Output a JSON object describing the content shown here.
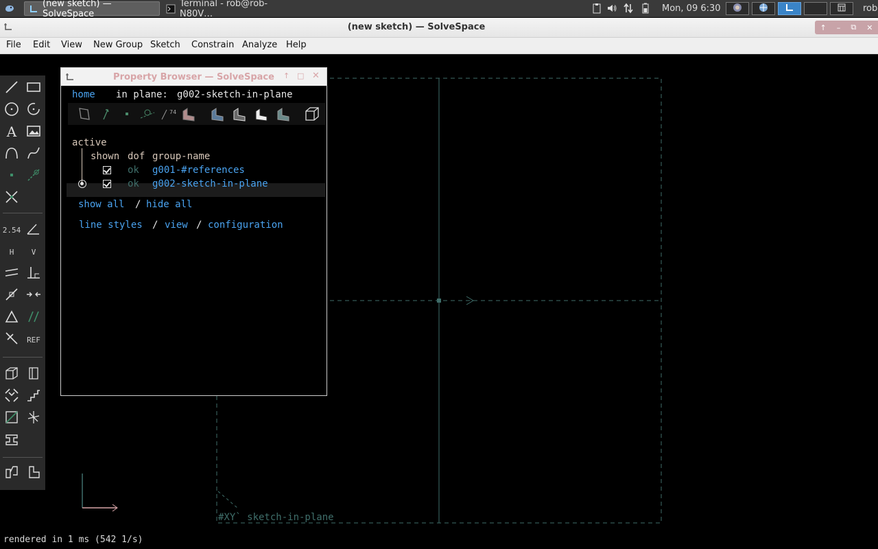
{
  "taskbar": {
    "tasks": [
      {
        "label": "(new sketch) — SolveSpace",
        "active": true
      },
      {
        "label": "Terminal - rob@rob-N80V…",
        "active": false
      }
    ],
    "clock": "Mon, 09  6:30",
    "user": "rob"
  },
  "window": {
    "title": "(new sketch) — SolveSpace",
    "menu": [
      "File",
      "Edit",
      "View",
      "New Group",
      "Sketch",
      "Constrain",
      "Analyze",
      "Help"
    ]
  },
  "toolbar": {
    "dimension_label": "2.54",
    "angle_label": "74°",
    "horizontal_label": "H",
    "vertical_label": "V",
    "reference_label": "REF",
    "icons": [
      "line-segment",
      "rectangle",
      "circle",
      "arc",
      "text",
      "image",
      "tangent-arc",
      "bezier-spline",
      "datum-point",
      "construction",
      "split-curves",
      "distance-dimension",
      "angle-dimension",
      "horizontal",
      "vertical",
      "parallel",
      "perpendicular",
      "point-on-line",
      "symmetric",
      "equal",
      "same-orientation",
      "other-supplementary",
      "reference",
      "nearest-iso-view",
      "nearest-ortho-view",
      "zoom-to-fit",
      "step-dimension",
      "sketch-in-3d",
      "sketch-in-plane",
      "extrude",
      "assemble",
      "lathe"
    ]
  },
  "property_browser": {
    "title": "Property Browser — SolveSpace",
    "nav": {
      "home": "home",
      "in_plane_label": "in plane:",
      "in_plane_value": "g002-sketch-in-plane"
    },
    "section_label": "active",
    "columns": {
      "shown": "shown",
      "dof": "dof",
      "group_name": "group-name"
    },
    "groups": [
      {
        "name": "g001-#references",
        "dof": "ok",
        "shown": true,
        "active": false
      },
      {
        "name": "g002-sketch-in-plane",
        "dof": "ok",
        "shown": true,
        "active": true
      }
    ],
    "show_all": "show all",
    "hide_all": "hide all",
    "separator": "/",
    "links": [
      "line styles",
      "view",
      "configuration"
    ]
  },
  "canvas": {
    "workplane_label": "#XY` sketch-in-plane",
    "status": "rendered in 1 ms (542 1/s)"
  }
}
